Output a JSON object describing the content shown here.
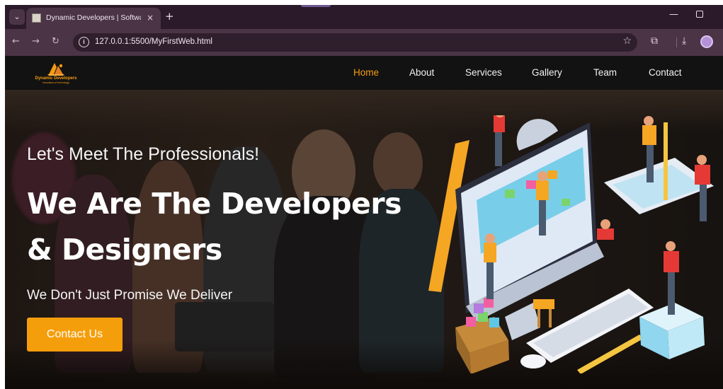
{
  "browser": {
    "tab_title": "Dynamic Developers | Software",
    "tab_close": "×",
    "new_tab": "+",
    "url": "127.0.0.1:5500/MyFirstWeb.html",
    "icons": [
      "tab-search-icon",
      "favicon-icon",
      "close-icon",
      "new-tab-icon",
      "minimize-icon",
      "restore-icon",
      "back-icon",
      "forward-icon",
      "reload-icon",
      "site-info-icon",
      "star-icon",
      "extensions-icon",
      "download-icon",
      "profile-avatar"
    ]
  },
  "site": {
    "logo": {
      "name": "Dynamic Developers",
      "tagline": "Innovators of technology"
    },
    "nav": [
      {
        "label": "Home",
        "active": true
      },
      {
        "label": "About",
        "active": false
      },
      {
        "label": "Services",
        "active": false
      },
      {
        "label": "Gallery",
        "active": false
      },
      {
        "label": "Team",
        "active": false
      },
      {
        "label": "Contact",
        "active": false
      }
    ],
    "hero": {
      "subheading": "Let's Meet The Professionals!",
      "heading_line1": "We Are The Developers",
      "heading_line2": "& Designers",
      "tagline": "We Don't Just Promise We Deliver",
      "cta_label": "Contact Us"
    }
  },
  "colors": {
    "accent": "#f39c12",
    "button": "#f59e0b",
    "nav_bg": "#121212",
    "browser_chrome": "#4a3446"
  }
}
